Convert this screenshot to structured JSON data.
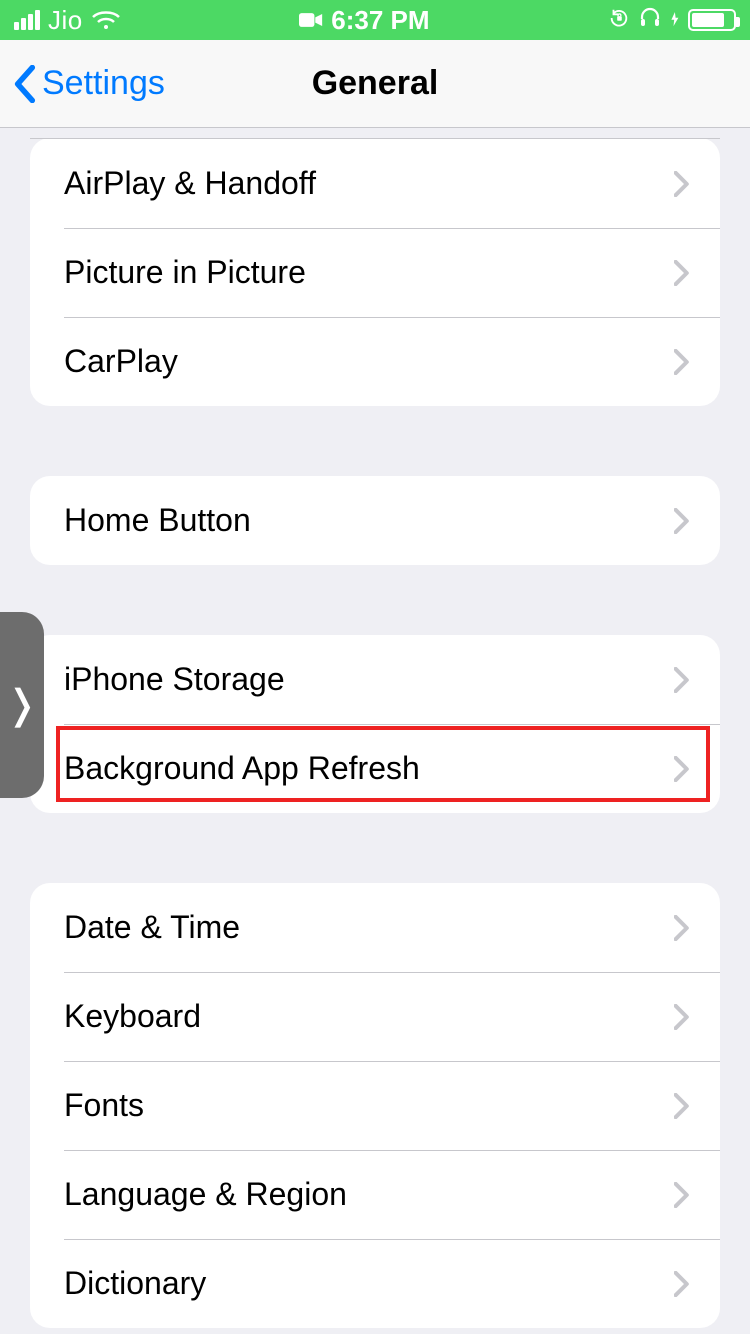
{
  "status": {
    "carrier": "Jio",
    "time": "6:37 PM"
  },
  "nav": {
    "back_label": "Settings",
    "title": "General"
  },
  "groups": [
    {
      "items": [
        {
          "key": "airplay-handoff",
          "label": "AirPlay & Handoff"
        },
        {
          "key": "picture-in-picture",
          "label": "Picture in Picture"
        },
        {
          "key": "carplay",
          "label": "CarPlay"
        }
      ]
    },
    {
      "items": [
        {
          "key": "home-button",
          "label": "Home Button"
        }
      ]
    },
    {
      "items": [
        {
          "key": "iphone-storage",
          "label": "iPhone Storage"
        },
        {
          "key": "background-app-refresh",
          "label": "Background App Refresh",
          "highlighted": true
        }
      ]
    },
    {
      "items": [
        {
          "key": "date-time",
          "label": "Date & Time"
        },
        {
          "key": "keyboard",
          "label": "Keyboard"
        },
        {
          "key": "fonts",
          "label": "Fonts"
        },
        {
          "key": "language-region",
          "label": "Language & Region"
        },
        {
          "key": "dictionary",
          "label": "Dictionary"
        }
      ]
    }
  ],
  "highlight_color": "#e22"
}
